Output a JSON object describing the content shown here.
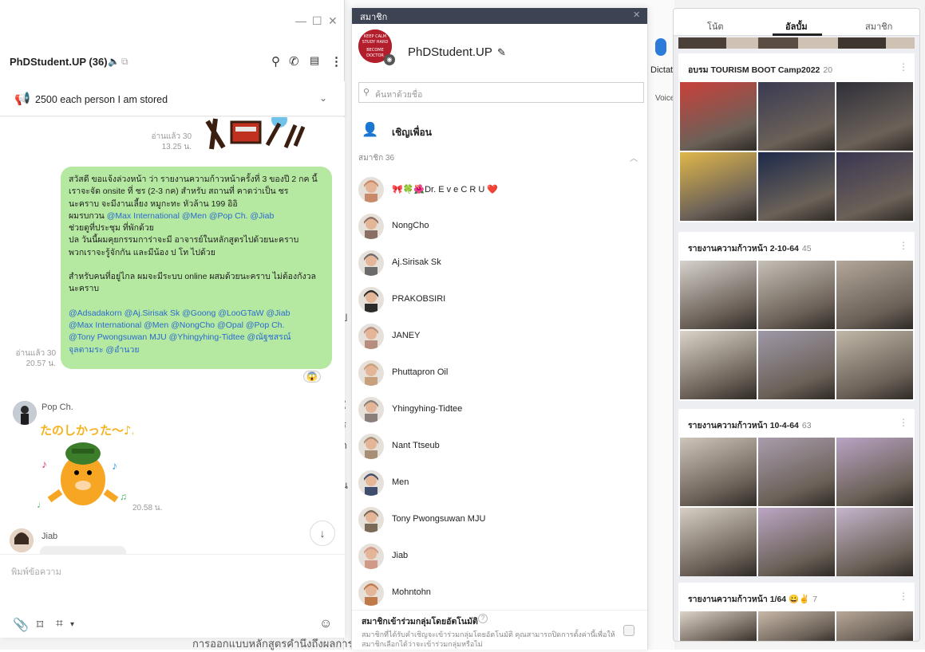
{
  "chat": {
    "window_controls": {
      "minimize": "—",
      "maximize": "☐",
      "close": "✕"
    },
    "group_name": "PhDStudent.UP (36)",
    "header_icons": [
      "search-icon",
      "call-icon",
      "notes-icon",
      "more-icon"
    ],
    "announcement": "2500 each person I am stored",
    "messages": {
      "read1": "อ่านแล้ว 30",
      "time1": "13.25 น.",
      "bubble_lines_p1": [
        "สวัสดี ขอแจ้งล่วงหน้า ว่า รายงานความก้าวหน้าครั้งที่ 3 ของปี 2 กค นี้",
        "เราจะจัด onsite ที่ ชร  (2-3 กค) สำหรับ สถานที่ คาดว่าเป็น ชร",
        "นะคราบ จะมีงานเลี้ยง หมูกะทะ หัวล้าน 199 อิอิ"
      ],
      "bubble_line_mentions_prefix": "ผมรบกวน ",
      "bubble_line_mentions": "@Max International @Men @Pop Ch. @Jiab",
      "bubble_lines_p1b": [
        "ช่วยดูที่ประชุม ที่พักด้วย",
        "ปล วันนี้ผมคุยกรรมการ่าจะมี อาจารย์ในหลักสูตรไปด้วยนะคราบ",
        "พวกเราจะรู้จักกัน และมีน้อง ป โท ไปด้วย"
      ],
      "bubble_p2": [
        "สำหรับคนที่อยู่ไกล ผมจะมีระบบ online ผสมด้วยนะคราบ ไม่ต้องกังวล",
        "นะคราบ"
      ],
      "bubble_p3": [
        "@Adsadakorn @Aj.Sirisak Sk @Goong @LooGTaW @Jiab",
        "@Max International @Men @NongCho @Opal @Pop Ch.",
        "@Tony Pwongsuwan MJU @Yhingyhing-Tidtee @ณัฐชสรณ์",
        "จุลตามระ @อำนวย"
      ],
      "read2": "อ่านแล้ว 30",
      "time2": "20.57 น.",
      "reaction": "😱",
      "pop_name": "Pop Ch.",
      "sticker_time": "20.58 น.",
      "jiab_name": "Jiab"
    },
    "composer_placeholder": "พิมพ์ข้อความ",
    "composer_icons": [
      "attach-icon",
      "bookmark-icon",
      "crop-icon",
      "emoji-icon"
    ]
  },
  "members_panel": {
    "title": "สมาชิก",
    "group_avatar_text": [
      "KEEP CALM",
      "STUDY HARD",
      "BECOME",
      "DOCTOR"
    ],
    "group_name": "PhDStudent.UP",
    "search_placeholder": "ค้นหาด้วยชื่อ",
    "invite_label": "เชิญเพื่อน",
    "member_count": "สมาชิก 36",
    "members": [
      {
        "name": "🎀🍀🌺Dr. E v e C R U ❤️",
        "color": "#c98a6a"
      },
      {
        "name": "NongCho",
        "color": "#8b6f64"
      },
      {
        "name": "Aj.Sirisak Sk",
        "color": "#6b6b6b"
      },
      {
        "name": "PRAKOBSIRI",
        "color": "#2c2c2c"
      },
      {
        "name": "JANEY",
        "color": "#b78d7f"
      },
      {
        "name": "Phuttapron Oil",
        "color": "#c7a07c"
      },
      {
        "name": "Yhingyhing-Tidtee",
        "color": "#8a7f7a"
      },
      {
        "name": "Nant Ttseub",
        "color": "#a88d77"
      },
      {
        "name": "Men",
        "color": "#3f4e6e"
      },
      {
        "name": "Tony Pwongsuwan MJU",
        "color": "#7b6a58"
      },
      {
        "name": "Jiab",
        "color": "#d09a86"
      },
      {
        "name": "Mohntohn",
        "color": "#c07a4a"
      }
    ],
    "auto_join_title": "สมาชิกเข้าร่วมกลุ่มโดยอัตโนมัติ",
    "auto_join_desc": "สมาชิกที่ได้รับคำเชิญจะเข้าร่วมกลุ่มโดยอัตโนมัติ คุณสามารถปิดการตั้งค่านี้เพื่อให้สมาชิกเลือกได้ว่าจะเข้าร่วมกลุ่มหรือไม่"
  },
  "dictate": {
    "label": "Dictat",
    "sub": "Voice"
  },
  "background_doc": {
    "bottom_text": "การออกแบบหลักสูตรคำนึงถึงผลการเรี",
    "fragments": [
      "ป",
      "เ",
      "า",
      "ใ",
      "เ",
      "ร",
      "ก",
      "ร",
      "ร",
      "น",
      "d",
      "เ"
    ]
  },
  "album_panel": {
    "tabs": [
      "โน้ต",
      "อัลบั้ม",
      "สมาชิก"
    ],
    "active_tab": "อัลบั้ม",
    "albums": [
      {
        "title": "อบรม TOURISM BOOT Camp2022",
        "count": "20"
      },
      {
        "title": "รายงานความก้าวหน้า 2-10-64",
        "count": "45"
      },
      {
        "title": "รายงานความก้าวหน้า 10-4-64",
        "count": "63"
      },
      {
        "title": "รายงานความก้าวหน้า 1/64 😀✌️",
        "count": "7"
      }
    ]
  }
}
